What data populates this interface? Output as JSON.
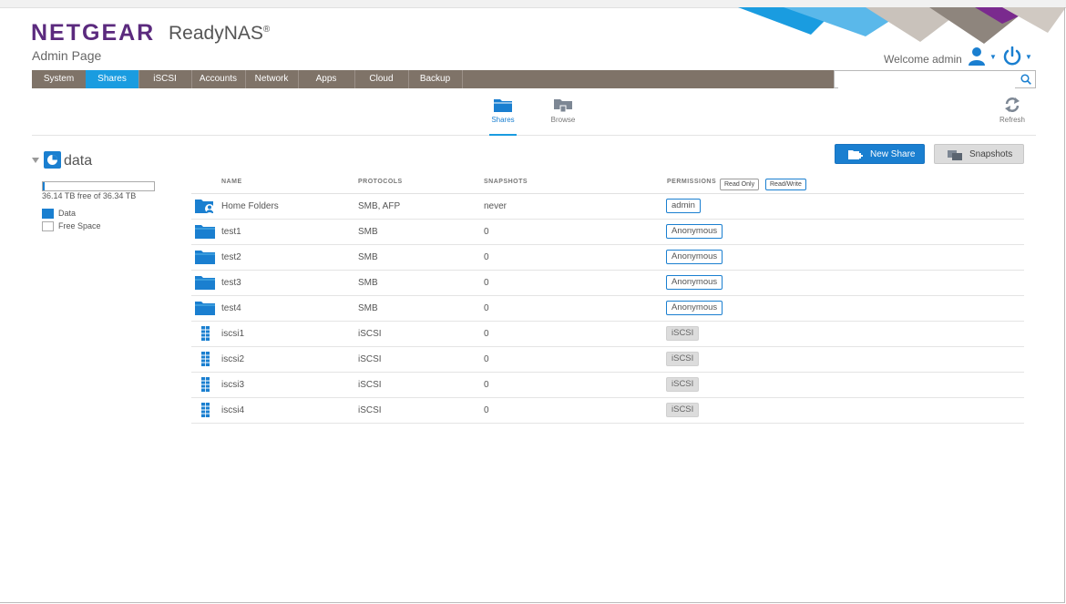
{
  "header": {
    "brand": "NETGEAR",
    "product": "ReadyNAS",
    "product_mark": "®",
    "page_label": "Admin Page",
    "welcome": "Welcome admin"
  },
  "colors": {
    "brand_purple": "#5b2a7e",
    "accent_blue": "#1a9ce0",
    "nav_bg": "#7f7368"
  },
  "nav": {
    "tabs": [
      {
        "label": "System"
      },
      {
        "label": "Shares",
        "active": true
      },
      {
        "label": "iSCSI"
      },
      {
        "label": "Accounts"
      },
      {
        "label": "Network"
      },
      {
        "label": "Apps"
      },
      {
        "label": "Cloud"
      },
      {
        "label": "Backup"
      }
    ],
    "search": {
      "value": "",
      "placeholder": ""
    }
  },
  "toolbar": {
    "shares_label": "Shares",
    "browse_label": "Browse",
    "refresh_label": "Refresh"
  },
  "volume": {
    "name": "data",
    "usage_text": "36.14 TB free of 36.34 TB",
    "used_fraction": 0.0055,
    "legend_data": "Data",
    "legend_free": "Free Space"
  },
  "actions": {
    "new_share": "New Share",
    "snapshots": "Snapshots"
  },
  "table": {
    "headers": {
      "name": "NAME",
      "protocols": "PROTOCOLS",
      "snapshots": "SNAPSHOTS",
      "permissions": "PERMISSIONS",
      "read_only": "Read Only",
      "read_write": "Read/Write"
    },
    "rows": [
      {
        "name": "Home Folders",
        "protocols": "SMB, AFP",
        "snapshots": "never",
        "permission": "admin",
        "icon": "home-folder-icon"
      },
      {
        "name": "test1",
        "protocols": "SMB",
        "snapshots": "0",
        "permission": "Anonymous",
        "icon": "folder-icon"
      },
      {
        "name": "test2",
        "protocols": "SMB",
        "snapshots": "0",
        "permission": "Anonymous",
        "icon": "folder-icon"
      },
      {
        "name": "test3",
        "protocols": "SMB",
        "snapshots": "0",
        "permission": "Anonymous",
        "icon": "folder-icon"
      },
      {
        "name": "test4",
        "protocols": "SMB",
        "snapshots": "0",
        "permission": "Anonymous",
        "icon": "folder-icon"
      },
      {
        "name": "iscsi1",
        "protocols": "iSCSI",
        "snapshots": "0",
        "permission": "iSCSI",
        "icon": "iscsi-lun-icon"
      },
      {
        "name": "iscsi2",
        "protocols": "iSCSI",
        "snapshots": "0",
        "permission": "iSCSI",
        "icon": "iscsi-lun-icon"
      },
      {
        "name": "iscsi3",
        "protocols": "iSCSI",
        "snapshots": "0",
        "permission": "iSCSI",
        "icon": "iscsi-lun-icon"
      },
      {
        "name": "iscsi4",
        "protocols": "iSCSI",
        "snapshots": "0",
        "permission": "iSCSI",
        "icon": "iscsi-lun-icon"
      }
    ]
  }
}
